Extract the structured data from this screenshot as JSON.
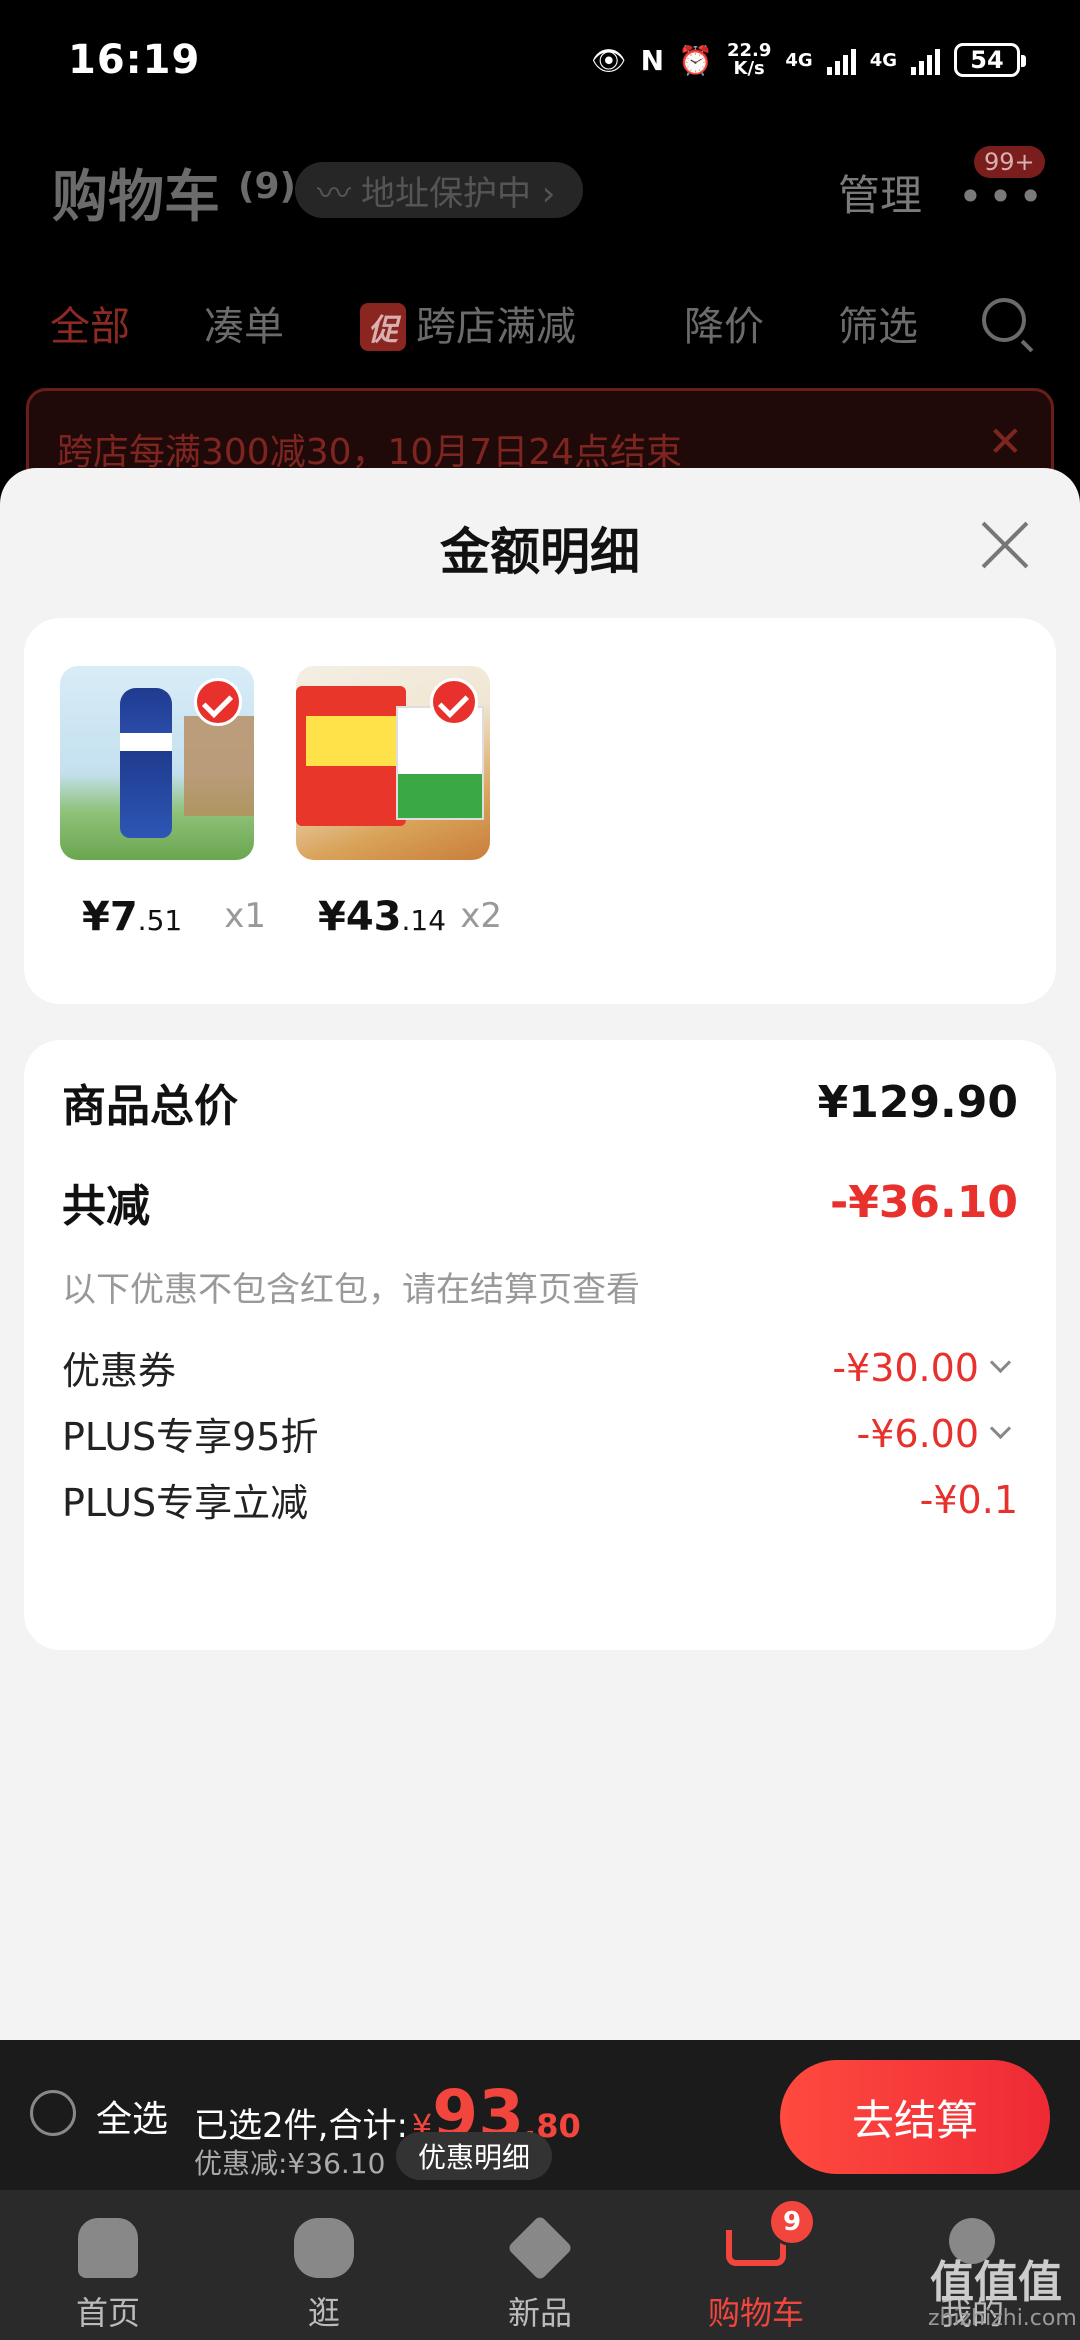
{
  "status_bar": {
    "time": "16:19",
    "speed": "22.9",
    "speed_unit": "K/s",
    "net1": "4G",
    "net2": "4G",
    "battery": "54"
  },
  "cart_header": {
    "title": "购物车",
    "count": "(9)",
    "address_pill": "地址保护中 ›",
    "manage": "管理",
    "more_badge": "99+"
  },
  "filter_tabs": [
    {
      "label": "全部",
      "active": true
    },
    {
      "label": "凑单"
    },
    {
      "label": "跨店满减",
      "tag": "促"
    },
    {
      "label": "降价"
    },
    {
      "label": "筛选"
    }
  ],
  "promo_banner": {
    "text": "跨店每满300减30，10月7日24点结束",
    "close": "✕"
  },
  "sheet": {
    "title": "金额明细",
    "products": [
      {
        "price_int": "¥7",
        "price_dec": ".51",
        "qty": "x1"
      },
      {
        "price_int": "¥43",
        "price_dec": ".14",
        "qty": "x2"
      }
    ],
    "details": {
      "total_label": "商品总价",
      "total_value": "¥129.90",
      "reduce_label": "共减",
      "reduce_value": "-¥36.10",
      "note": "以下优惠不包含红包，请在结算页查看",
      "coupon_label": "优惠券",
      "coupon_value": "-¥30.00",
      "plus95_label": "PLUS专享95折",
      "plus95_value": "-¥6.00",
      "plus_reduce_label": "PLUS专享立减",
      "plus_reduce_value": "-¥0.1"
    }
  },
  "checkout": {
    "select_all": "全选",
    "selected_text": "已选2件,合计:",
    "currency": "¥",
    "total_int": "93",
    "total_dec": ".80",
    "discount_text": "优惠减:¥36.10",
    "detail_button": "优惠明细",
    "checkout_button": "去结算"
  },
  "bottom_nav": [
    {
      "label": "首页",
      "icon": "home-icon"
    },
    {
      "label": "逛",
      "icon": "bear-icon"
    },
    {
      "label": "新品",
      "icon": "cube-icon"
    },
    {
      "label": "购物车",
      "icon": "cart-icon",
      "active": true,
      "badge": "9"
    },
    {
      "label": "我的",
      "icon": "profile-icon"
    }
  ],
  "watermark": {
    "logo": "值值值",
    "site": "zhizhizhi.com"
  },
  "colors": {
    "accent": "#e8312c",
    "sheet_bg": "#f3f3f3",
    "card_bg": "#ffffff"
  }
}
